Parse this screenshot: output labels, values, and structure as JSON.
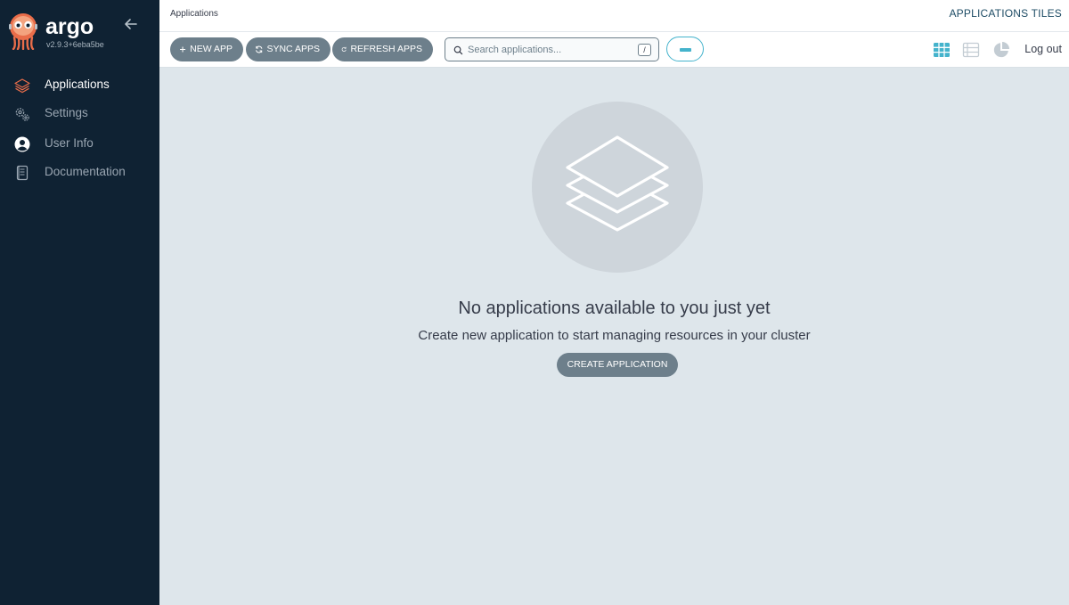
{
  "app": {
    "name": "argo",
    "version": "v2.9.3+6eba5be"
  },
  "sidebar": {
    "items": [
      {
        "label": "Applications",
        "icon": "layers-icon",
        "active": true
      },
      {
        "label": "Settings",
        "icon": "gears-icon",
        "active": false
      },
      {
        "label": "User Info",
        "icon": "user-circle-icon",
        "active": false
      },
      {
        "label": "Documentation",
        "icon": "book-icon",
        "active": false
      }
    ]
  },
  "header": {
    "breadcrumb": "Applications",
    "title": "APPLICATIONS TILES"
  },
  "toolbar": {
    "new_app": "NEW APP",
    "sync_apps": "SYNC APPS",
    "refresh_apps": "REFRESH APPS",
    "search_placeholder": "Search applications...",
    "search_shortcut": "/",
    "logout": "Log out"
  },
  "empty_state": {
    "title": "No applications available to you just yet",
    "subtitle": "Create new application to start managing resources in your cluster",
    "button": "CREATE APPLICATION"
  },
  "colors": {
    "sidebar_bg": "#0f2233",
    "page_bg": "#dee6eb",
    "button_bg": "#6d7f8b",
    "accent": "#44b3cc",
    "brand_orange": "#e96d4a"
  }
}
